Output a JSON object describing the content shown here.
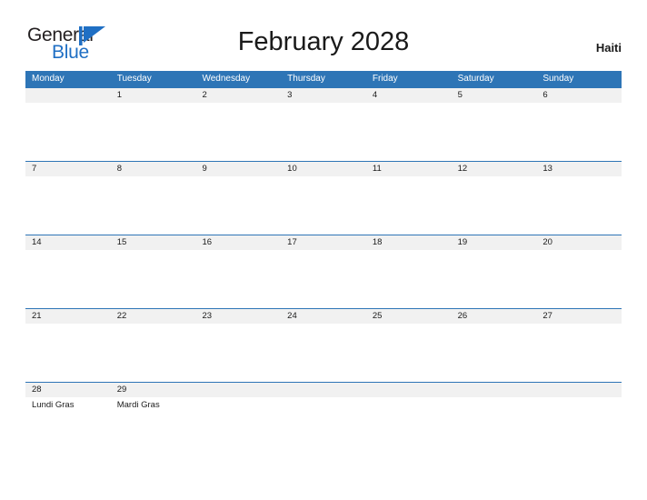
{
  "branding": {
    "logo_line1": "General",
    "logo_line2": "Blue",
    "logo_dark_color": "#231f20",
    "logo_blue_color": "#1f6fc4",
    "flag_icon": "blue-triangle-flag-icon"
  },
  "header": {
    "title": "February 2028",
    "country": "Haiti"
  },
  "colors": {
    "header_bar": "#2e75b6",
    "date_band": "#f1f1f1",
    "row_divider": "#2e75b6",
    "page_background": "#ffffff",
    "text": "#1a1a1a",
    "header_text": "#ffffff"
  },
  "weekdays": [
    {
      "label": "Monday"
    },
    {
      "label": "Tuesday"
    },
    {
      "label": "Wednesday"
    },
    {
      "label": "Thursday"
    },
    {
      "label": "Friday"
    },
    {
      "label": "Saturday"
    },
    {
      "label": "Sunday"
    }
  ],
  "weeks": [
    {
      "days": [
        {
          "date": "",
          "holiday": ""
        },
        {
          "date": "1",
          "holiday": ""
        },
        {
          "date": "2",
          "holiday": ""
        },
        {
          "date": "3",
          "holiday": ""
        },
        {
          "date": "4",
          "holiday": ""
        },
        {
          "date": "5",
          "holiday": ""
        },
        {
          "date": "6",
          "holiday": ""
        }
      ]
    },
    {
      "days": [
        {
          "date": "7",
          "holiday": ""
        },
        {
          "date": "8",
          "holiday": ""
        },
        {
          "date": "9",
          "holiday": ""
        },
        {
          "date": "10",
          "holiday": ""
        },
        {
          "date": "11",
          "holiday": ""
        },
        {
          "date": "12",
          "holiday": ""
        },
        {
          "date": "13",
          "holiday": ""
        }
      ]
    },
    {
      "days": [
        {
          "date": "14",
          "holiday": ""
        },
        {
          "date": "15",
          "holiday": ""
        },
        {
          "date": "16",
          "holiday": ""
        },
        {
          "date": "17",
          "holiday": ""
        },
        {
          "date": "18",
          "holiday": ""
        },
        {
          "date": "19",
          "holiday": ""
        },
        {
          "date": "20",
          "holiday": ""
        }
      ]
    },
    {
      "days": [
        {
          "date": "21",
          "holiday": ""
        },
        {
          "date": "22",
          "holiday": ""
        },
        {
          "date": "23",
          "holiday": ""
        },
        {
          "date": "24",
          "holiday": ""
        },
        {
          "date": "25",
          "holiday": ""
        },
        {
          "date": "26",
          "holiday": ""
        },
        {
          "date": "27",
          "holiday": ""
        }
      ]
    },
    {
      "days": [
        {
          "date": "28",
          "holiday": "Lundi Gras"
        },
        {
          "date": "29",
          "holiday": "Mardi Gras"
        },
        {
          "date": "",
          "holiday": ""
        },
        {
          "date": "",
          "holiday": ""
        },
        {
          "date": "",
          "holiday": ""
        },
        {
          "date": "",
          "holiday": ""
        },
        {
          "date": "",
          "holiday": ""
        }
      ]
    }
  ]
}
